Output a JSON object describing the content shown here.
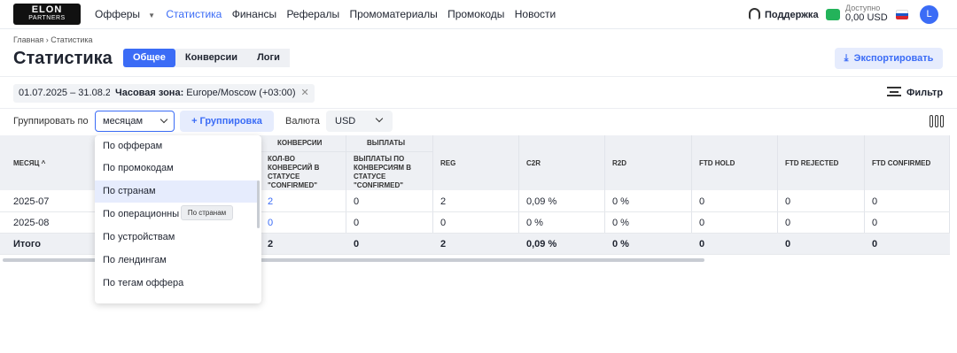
{
  "header": {
    "logo_top": "ELON",
    "logo_bottom": "PARTNERS",
    "nav": [
      "Офферы",
      "Статистика",
      "Финансы",
      "Рефералы",
      "Промоматериалы",
      "Промокоды",
      "Новости"
    ],
    "support": "Поддержка",
    "balance_label": "Доступно",
    "balance_value": "0,00 USD",
    "avatar": "L",
    "accent": "#3b6cf6"
  },
  "breadcrumb": "Главная › Статистика",
  "page_title": "Статистика",
  "tabs": [
    "Общее",
    "Конверсии",
    "Логи"
  ],
  "export_label": "Экспортировать",
  "filters": {
    "date": "01.07.2025 – 31.08.2025",
    "timezone_label": "Часовая зона:",
    "timezone_value": "Europe/Moscow (+03:00)",
    "filter_label": "Фильтр"
  },
  "grouping": {
    "label": "Группировать по",
    "value": "месяцам",
    "add_button": "+ Группировка",
    "currency_label": "Валюта",
    "currency_value": "USD"
  },
  "table": {
    "group_conversions": "Конверсии",
    "group_payouts": "Выплаты",
    "headers": [
      "Месяц ^",
      "Кол-во конверсий в статусе \"confirmed\"",
      "Выплаты по конверсиям в статусе \"confirmed\"",
      "REG",
      "C2R",
      "R2D",
      "FTD HOLD",
      "FTD REJECTED",
      "FTD CONFIRMED"
    ],
    "rows": [
      [
        "2025-07",
        "2",
        "0",
        "2",
        "0,09 %",
        "0 %",
        "0",
        "0",
        "0"
      ],
      [
        "2025-08",
        "0",
        "0",
        "0",
        "0 %",
        "0 %",
        "0",
        "0",
        "0"
      ]
    ],
    "total": [
      "Итого",
      "2",
      "0",
      "2",
      "0,09 %",
      "0 %",
      "0",
      "0",
      "0"
    ]
  },
  "dropdown": {
    "options": [
      "По офферам",
      "По промокодам",
      "По странам",
      "По операционны",
      "По устройствам",
      "По лендингам",
      "По тегам оффера"
    ],
    "highlighted": "По странам",
    "tooltip": "По странам"
  }
}
